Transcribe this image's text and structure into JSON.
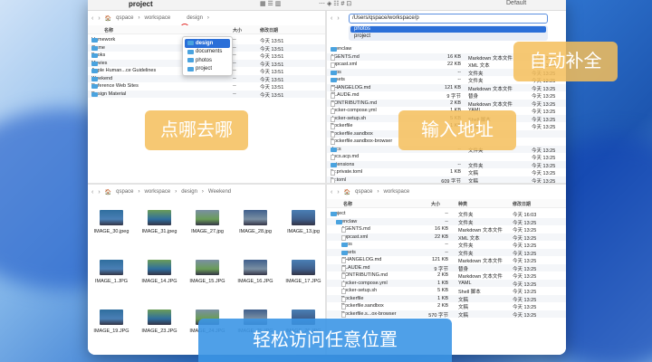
{
  "window": {
    "title": "project",
    "view_mode": "Default"
  },
  "pane1": {
    "path": [
      "qspace",
      "workspace",
      "design"
    ],
    "columns": [
      "名称",
      "大小",
      "修改日期"
    ],
    "rows": [
      {
        "name": "Homework",
        "size": "--",
        "date": "今天 13:51"
      },
      {
        "name": "Game",
        "size": "--",
        "date": "今天 13:51"
      },
      {
        "name": "Books",
        "size": "--",
        "date": "今天 13:51"
      },
      {
        "name": "Movies",
        "size": "--",
        "date": "今天 13:51"
      },
      {
        "name": "Apple Human...ce Guidelines",
        "size": "--",
        "date": "今天 13:51"
      },
      {
        "name": "Weekend",
        "size": "--",
        "date": "今天 13:51"
      },
      {
        "name": "Reference Web Sites",
        "size": "--",
        "date": "今天 13:51"
      },
      {
        "name": "Design Material",
        "size": "--",
        "date": "今天 13:51"
      }
    ],
    "dropdown": [
      "design",
      "documents",
      "photos",
      "project"
    ]
  },
  "pane2": {
    "address": "/Users/qspace/workspace/p",
    "suggestions": [
      "photos",
      "project"
    ],
    "rows": [
      {
        "name": "openclaw",
        "size": "",
        "kind": "",
        "date": "",
        "folder": true
      },
      {
        "name": "AGENTS.md",
        "size": "16 KB",
        "kind": "Markdown 文本文件",
        "date": "今天 13:25"
      },
      {
        "name": "appcast.xml",
        "size": "22 KB",
        "kind": "XML 文本",
        "date": "今天 13:25"
      },
      {
        "name": "apps",
        "size": "--",
        "kind": "文件夹",
        "date": "今天 13:25",
        "folder": true
      },
      {
        "name": "assets",
        "size": "--",
        "kind": "文件夹",
        "date": "今天 13:25",
        "folder": true
      },
      {
        "name": "CHANGELOG.md",
        "size": "121 KB",
        "kind": "Markdown 文本文件",
        "date": "今天 13:25"
      },
      {
        "name": "CLAUDE.md",
        "size": "9 字节",
        "kind": "替身",
        "date": "今天 13:25"
      },
      {
        "name": "CONTRIBUTING.md",
        "size": "2 KB",
        "kind": "Markdown 文本文件",
        "date": "今天 13:25"
      },
      {
        "name": "docker-compose.yml",
        "size": "1 KB",
        "kind": "YAML",
        "date": "今天 13:25"
      },
      {
        "name": "docker-setup.sh",
        "size": "5 KB",
        "kind": "Shell 脚本",
        "date": "今天 13:25"
      },
      {
        "name": "Dockerfile",
        "size": "1 KB",
        "kind": "文稿",
        "date": "今天 13:25"
      },
      {
        "name": "Dockerfile.sandbox",
        "size": "",
        "kind": "",
        "date": ""
      },
      {
        "name": "Dockerfile.sandbox-browser",
        "size": "",
        "kind": "",
        "date": ""
      },
      {
        "name": "docs",
        "size": "--",
        "kind": "文件夹",
        "date": "今天 13:25",
        "folder": true
      },
      {
        "name": "docs.acp.md",
        "size": "",
        "kind": "",
        "date": "今天 13:25"
      },
      {
        "name": "extensions",
        "size": "--",
        "kind": "文件夹",
        "date": "今天 13:25",
        "folder": true
      },
      {
        "name": "fly.private.toml",
        "size": "1 KB",
        "kind": "文稿",
        "date": "今天 13:25"
      },
      {
        "name": "fly.toml",
        "size": "609 字节",
        "kind": "文稿",
        "date": "今天 13:25"
      },
      {
        "name": "git-hooks",
        "size": "--",
        "kind": "文件夹",
        "date": "今天 13:25",
        "folder": true
      }
    ]
  },
  "pane3": {
    "path": [
      "qspace",
      "workspace",
      "design",
      "Weekend"
    ],
    "thumbs": [
      "IMAGE_30.jpeg",
      "IMAGE_31.jpeg",
      "IMAGE_27.jpg",
      "IMAGE_28.jpg",
      "IMAGE_13.jpg",
      "IMAGE_1.JPG",
      "IMAGE_14.JPG",
      "IMAGE_15.JPG",
      "IMAGE_16.JPG",
      "IMAGE_17.JPG",
      "IMAGE_19.JPG",
      "IMAGE_23.JPG",
      "IMAGE_24.JPG",
      "IMAGE_25.JPG",
      "IMAGE_26.JPG"
    ]
  },
  "pane4": {
    "path": [
      "qspace",
      "workspace"
    ],
    "columns": [
      "名称",
      "大小",
      "种类",
      "修改日期"
    ],
    "rows": [
      {
        "name": "project",
        "size": "--",
        "kind": "文件夹",
        "date": "今天 16:03",
        "folder": true,
        "indent": 0
      },
      {
        "name": "openclaw",
        "size": "--",
        "kind": "文件夹",
        "date": "今天 13:25",
        "folder": true,
        "indent": 1
      },
      {
        "name": "AGENTS.md",
        "size": "16 KB",
        "kind": "Markdown 文本文件",
        "date": "今天 13:25",
        "indent": 2
      },
      {
        "name": "appcast.xml",
        "size": "22 KB",
        "kind": "XML 文本",
        "date": "今天 13:25",
        "indent": 2
      },
      {
        "name": "apps",
        "size": "--",
        "kind": "文件夹",
        "date": "今天 13:25",
        "folder": true,
        "indent": 2
      },
      {
        "name": "assets",
        "size": "--",
        "kind": "文件夹",
        "date": "今天 13:25",
        "folder": true,
        "indent": 2
      },
      {
        "name": "CHANGELOG.md",
        "size": "121 KB",
        "kind": "Markdown 文本文件",
        "date": "今天 13:25",
        "indent": 2
      },
      {
        "name": "CLAUDE.md",
        "size": "9 字节",
        "kind": "替身",
        "date": "今天 13:25",
        "indent": 2
      },
      {
        "name": "CONTRIBUTING.md",
        "size": "2 KB",
        "kind": "Markdown 文本文件",
        "date": "今天 13:25",
        "indent": 2
      },
      {
        "name": "docker-compose.yml",
        "size": "1 KB",
        "kind": "YAML",
        "date": "今天 13:25",
        "indent": 2
      },
      {
        "name": "docker-setup.sh",
        "size": "5 KB",
        "kind": "Shell 脚本",
        "date": "今天 13:25",
        "indent": 2
      },
      {
        "name": "Dockerfile",
        "size": "1 KB",
        "kind": "文稿",
        "date": "今天 13:25",
        "indent": 2
      },
      {
        "name": "Dockerfile.sandbox",
        "size": "2 KB",
        "kind": "文稿",
        "date": "今天 13:25",
        "indent": 2
      },
      {
        "name": "Dockerfile.s...ox-browser",
        "size": "570 字节",
        "kind": "文稿",
        "date": "今天 13:25",
        "indent": 2
      }
    ]
  },
  "overlays": {
    "click_where": "点哪去哪",
    "type_address": "输入地址",
    "autocomplete": "自动补全",
    "easy_access": "轻松访问任意位置"
  }
}
